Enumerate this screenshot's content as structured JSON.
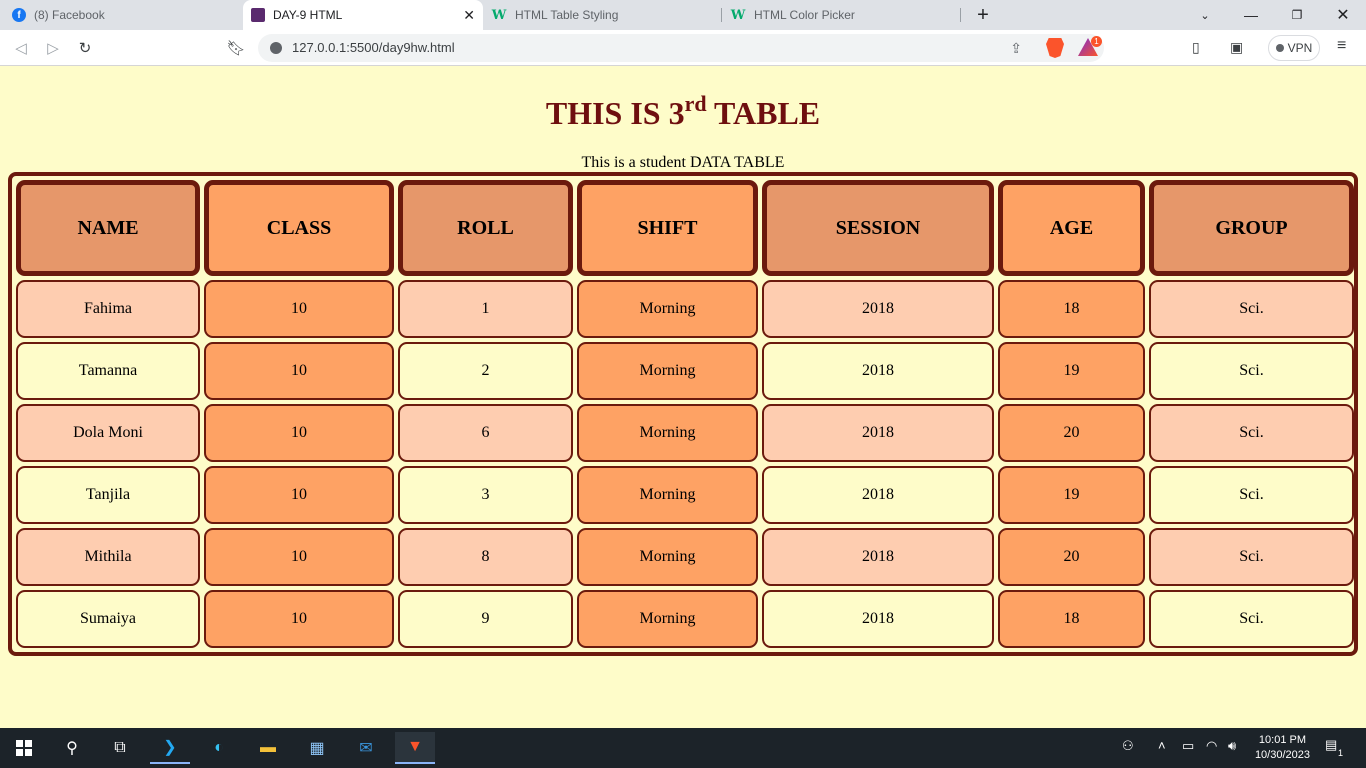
{
  "browser": {
    "tabs": [
      {
        "title": "(8) Facebook",
        "icon": "facebook-icon"
      },
      {
        "title": "DAY-9 HTML",
        "icon": "brave-page-icon",
        "active": true
      },
      {
        "title": "HTML Table Styling",
        "icon": "w3schools-icon"
      },
      {
        "title": "HTML Color Picker",
        "icon": "w3schools-icon"
      }
    ],
    "url": "127.0.0.1:5500/day9hw.html",
    "rewards_badge": "1",
    "vpn_label": "VPN"
  },
  "page": {
    "title_main": "THIS IS 3",
    "title_sup": "rd",
    "title_end": " TABLE",
    "caption": "This is a student DATA TABLE",
    "headers": [
      "NAME",
      "CLASS",
      "ROLL",
      "SHIFT",
      "SESSION",
      "AGE",
      "GROUP"
    ],
    "rows": [
      [
        "Fahima",
        "10",
        "1",
        "Morning",
        "2018",
        "18",
        "Sci."
      ],
      [
        "Tamanna",
        "10",
        "2",
        "Morning",
        "2018",
        "19",
        "Sci."
      ],
      [
        "Dola Moni",
        "10",
        "6",
        "Morning",
        "2018",
        "20",
        "Sci."
      ],
      [
        "Tanjila",
        "10",
        "3",
        "Morning",
        "2018",
        "19",
        "Sci."
      ],
      [
        "Mithila",
        "10",
        "8",
        "Morning",
        "2018",
        "20",
        "Sci."
      ],
      [
        "Sumaiya",
        "10",
        "9",
        "Morning",
        "2018",
        "18",
        "Sci."
      ]
    ],
    "colors": {
      "title": "#6e0f0f",
      "border": "#6b1a0d",
      "page_bg": "#fefcc9",
      "header_dark": "#e6976a",
      "header_orange": "#fea264",
      "row_light": "#fecdb0",
      "row_cream": "#fefcc9",
      "cell_orange": "#fea264"
    }
  },
  "taskbar": {
    "time": "10:01 PM",
    "date": "10/30/2023",
    "notification_count": "1"
  }
}
